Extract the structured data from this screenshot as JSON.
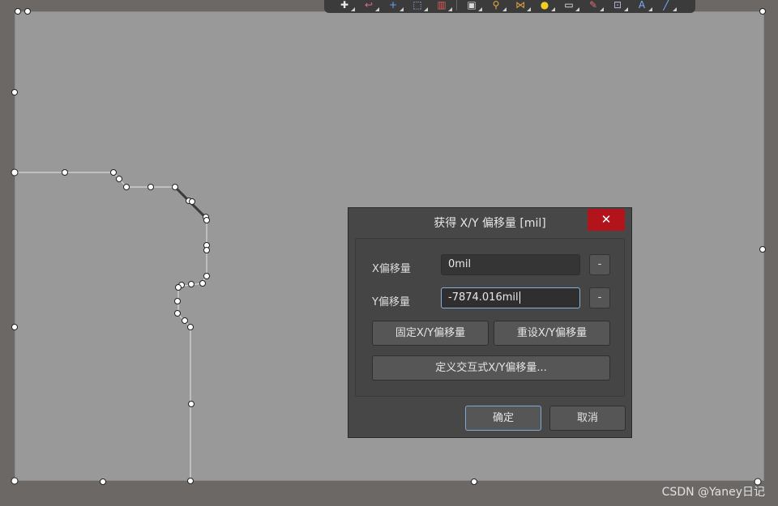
{
  "toolbar": {
    "tools": [
      {
        "name": "route-icon",
        "glyph": "✚",
        "color": "#e8e8e8"
      },
      {
        "name": "arc-icon",
        "glyph": "↩",
        "color": "#e06b8b"
      },
      {
        "name": "cross-icon",
        "glyph": "+",
        "color": "#6aa0ff"
      },
      {
        "name": "select-rect-icon",
        "glyph": "⬚",
        "color": "#9ab8ff"
      },
      {
        "name": "bar-chart-icon",
        "glyph": "▥",
        "color": "#e05a5a"
      },
      {
        "name": "component-icon",
        "glyph": "▣",
        "color": "#dcdcdc"
      },
      {
        "name": "probe-icon",
        "glyph": "⚲",
        "color": "#e0b040"
      },
      {
        "name": "net-icon",
        "glyph": "⋈",
        "color": "#e0a040"
      },
      {
        "name": "bulb-icon",
        "glyph": "●",
        "color": "#f0d020"
      },
      {
        "name": "note-icon",
        "glyph": "▭",
        "color": "#f0f0f0"
      },
      {
        "name": "edit-icon",
        "glyph": "✎",
        "color": "#e07070"
      },
      {
        "name": "clip-icon",
        "glyph": "⊡",
        "color": "#bcbcdc"
      },
      {
        "name": "text-icon",
        "glyph": "A",
        "color": "#7ab0ff"
      },
      {
        "name": "line-icon",
        "glyph": "╱",
        "color": "#7ab0ff"
      }
    ]
  },
  "dialog": {
    "title": "获得 X/Y 偏移量 [mil]",
    "close_glyph": "✕",
    "x_label": "X偏移量",
    "x_value": "0mil",
    "y_label": "Y偏移量",
    "y_value": "-7874.016mil",
    "minus_label": "-",
    "fix_button": "固定X/Y偏移量",
    "reset_button": "重设X/Y偏移量",
    "define_button": "定义交互式X/Y偏移量...",
    "ok_button": "确定",
    "cancel_button": "取消"
  },
  "watermark": "CSDN @Yaney日记"
}
